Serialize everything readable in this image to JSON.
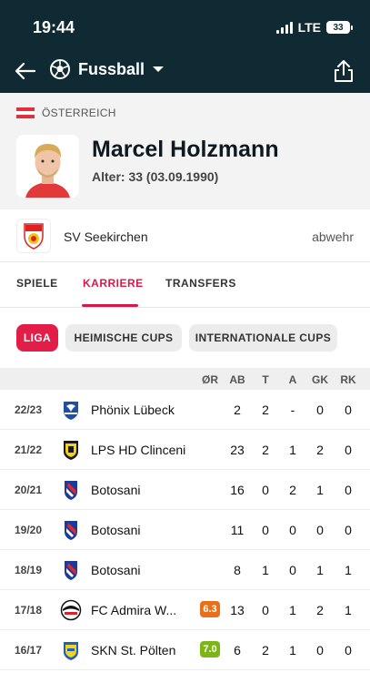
{
  "status": {
    "time": "19:44",
    "network": "LTE",
    "battery": "33"
  },
  "nav": {
    "sport": "Fussball"
  },
  "player": {
    "country": "ÖSTERREICH",
    "name": "Marcel Holzmann",
    "age": "Alter: 33 (03.09.1990)",
    "club": "SV Seekirchen",
    "position": "abwehr"
  },
  "tabs": [
    {
      "label": "SPIELE",
      "active": false
    },
    {
      "label": "KARRIERE",
      "active": true
    },
    {
      "label": "TRANSFERS",
      "active": false
    }
  ],
  "filters": [
    {
      "label": "LIGA",
      "active": true
    },
    {
      "label": "HEIMISCHE CUPS",
      "active": false
    },
    {
      "label": "INTERNATIONALE CUPS",
      "active": false
    }
  ],
  "table": {
    "headers": [
      "ØR",
      "AB",
      "T",
      "A",
      "GK",
      "RK"
    ],
    "rows": [
      {
        "season": "22/23",
        "team": "Phönix Lübeck",
        "rating": "",
        "ab": "2",
        "t": "2",
        "a": "-",
        "gk": "0",
        "rk": "0"
      },
      {
        "season": "21/22",
        "team": "LPS HD Clinceni",
        "rating": "",
        "ab": "23",
        "t": "2",
        "a": "1",
        "gk": "2",
        "rk": "0"
      },
      {
        "season": "20/21",
        "team": "Botosani",
        "rating": "",
        "ab": "16",
        "t": "0",
        "a": "2",
        "gk": "1",
        "rk": "0"
      },
      {
        "season": "19/20",
        "team": "Botosani",
        "rating": "",
        "ab": "11",
        "t": "0",
        "a": "0",
        "gk": "0",
        "rk": "0"
      },
      {
        "season": "18/19",
        "team": "Botosani",
        "rating": "",
        "ab": "8",
        "t": "1",
        "a": "0",
        "gk": "1",
        "rk": "1"
      },
      {
        "season": "17/18",
        "team": "FC Admira W...",
        "rating": "6.3",
        "ab": "13",
        "t": "0",
        "a": "1",
        "gk": "2",
        "rk": "1"
      },
      {
        "season": "16/17",
        "team": "SKN St. Pölten",
        "rating": "7.0",
        "ab": "6",
        "t": "2",
        "a": "1",
        "gk": "0",
        "rk": "0"
      }
    ]
  },
  "colors": {
    "header_bg": "#0f2a33",
    "accent": "#e11d48",
    "rating_orange": "#e8701a",
    "rating_green": "#7cb518"
  }
}
